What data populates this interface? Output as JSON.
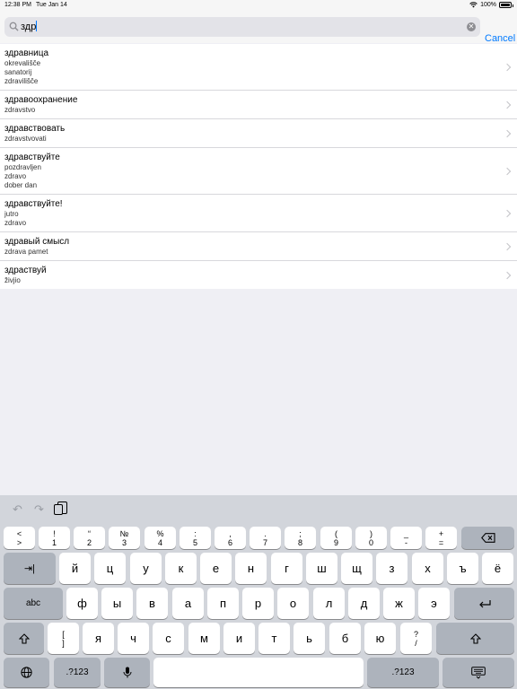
{
  "status": {
    "time": "12:38 PM",
    "date": "Tue Jan 14",
    "battery": "100%"
  },
  "search": {
    "query": "здр",
    "cancel_label": "Cancel"
  },
  "results": [
    {
      "title": "здравница",
      "subs": [
        "okrevališče",
        "sanatorij",
        "zdravilišče"
      ]
    },
    {
      "title": "здравоохранение",
      "subs": [
        "zdravstvo"
      ]
    },
    {
      "title": "здравствовать",
      "subs": [
        "zdravstvovati"
      ]
    },
    {
      "title": "здравствуйте",
      "subs": [
        "pozdravljen",
        "zdravo",
        "dober dan"
      ]
    },
    {
      "title": "здравствуйте!",
      "subs": [
        "jutro",
        "zdravo"
      ]
    },
    {
      "title": "здравый смысл",
      "subs": [
        "zdrava pamet"
      ]
    },
    {
      "title": "здраствуй",
      "subs": [
        "živjio"
      ]
    }
  ],
  "keyboard": {
    "numrow": [
      {
        "top": "<",
        "bot": ">"
      },
      {
        "top": "!",
        "bot": "1"
      },
      {
        "top": "“",
        "bot": "2"
      },
      {
        "top": "№",
        "bot": "3"
      },
      {
        "top": "%",
        "bot": "4"
      },
      {
        "top": ":",
        "bot": "5"
      },
      {
        "top": ",",
        "bot": "6"
      },
      {
        "top": ".",
        "bot": "7"
      },
      {
        "top": ";",
        "bot": "8"
      },
      {
        "top": "(",
        "bot": "9"
      },
      {
        "top": ")",
        "bot": "0"
      },
      {
        "top": "_",
        "bot": "-"
      },
      {
        "top": "+",
        "bot": "="
      }
    ],
    "row1": [
      "й",
      "ц",
      "у",
      "к",
      "е",
      "н",
      "г",
      "ш",
      "щ",
      "з",
      "х",
      "ъ",
      "ё"
    ],
    "row2": [
      "ф",
      "ы",
      "в",
      "а",
      "п",
      "р",
      "о",
      "л",
      "д",
      "ж",
      "э"
    ],
    "row3": [
      "я",
      "ч",
      "с",
      "м",
      "и",
      "т",
      "ь",
      "б",
      "ю"
    ],
    "bracket": {
      "top": "[",
      "bot": "]"
    },
    "question": {
      "top": "?",
      "bot": "/"
    },
    "tab_label": "⇥|",
    "abc_label": "abc",
    "numbers_label": ".?123",
    "return_icon": "return-icon",
    "shift_icon": "shift-icon",
    "globe_icon": "globe-icon",
    "mic_icon": "mic-icon",
    "hide_icon": "keyboard-hide-icon",
    "delete_icon": "delete-icon"
  }
}
